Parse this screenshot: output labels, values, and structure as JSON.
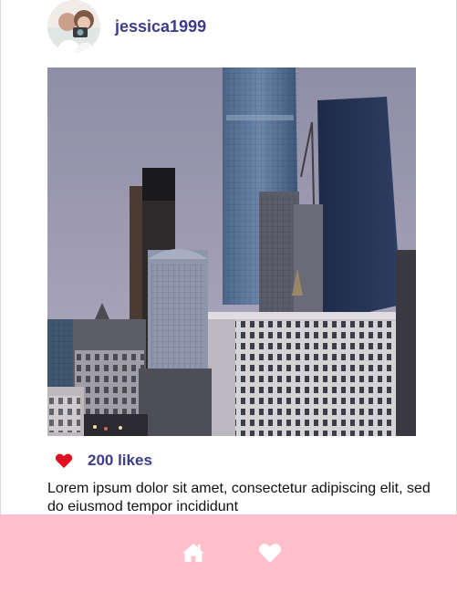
{
  "profile": {
    "username": "jessica1999",
    "avatar_icon": "user-avatar-photo"
  },
  "post": {
    "image_alt": "City skyline with skyscrapers at dusk",
    "likes_label": "200 likes",
    "like_icon": "heart-icon",
    "caption": "Lorem ipsum dolor sit amet, consectetur adipiscing elit, sed do eiusmod tempor incididunt"
  },
  "bottom_nav": {
    "items": [
      {
        "icon": "home-icon"
      },
      {
        "icon": "heart-icon"
      }
    ],
    "background": "#ffc0cb"
  },
  "colors": {
    "accent": "#3c3c8c",
    "like": "#e01020"
  }
}
